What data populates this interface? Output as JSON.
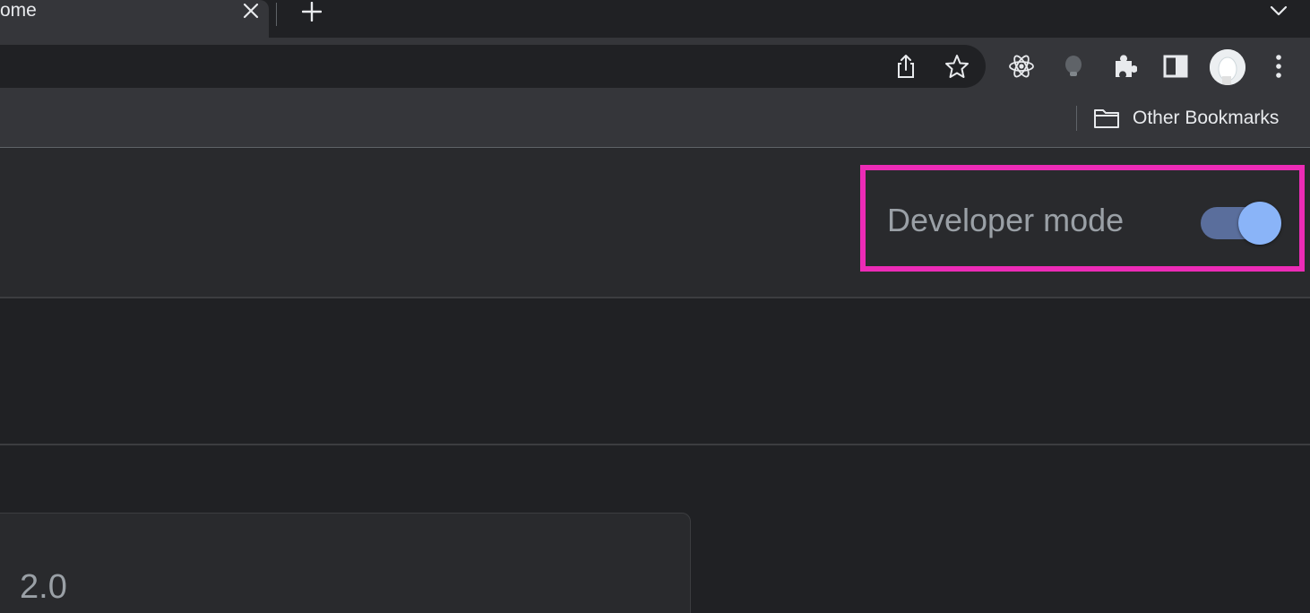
{
  "tab": {
    "title": "ome"
  },
  "toolbar": {
    "icons": [
      "share-icon",
      "bookmark-star-icon",
      "react-devtools-icon",
      "extension-dot-icon",
      "extensions-puzzle-icon",
      "side-panel-icon",
      "profile-avatar",
      "more-menu-icon"
    ]
  },
  "bookmarks": {
    "other_label": "Other Bookmarks"
  },
  "extensions_page": {
    "developer_mode_label": "Developer mode",
    "developer_mode_on": true,
    "card_version": "2.0"
  },
  "colors": {
    "highlight_border": "#ec2bb6",
    "toggle_knob": "#8ab4f8",
    "toggle_track": "#5a6e9c"
  }
}
